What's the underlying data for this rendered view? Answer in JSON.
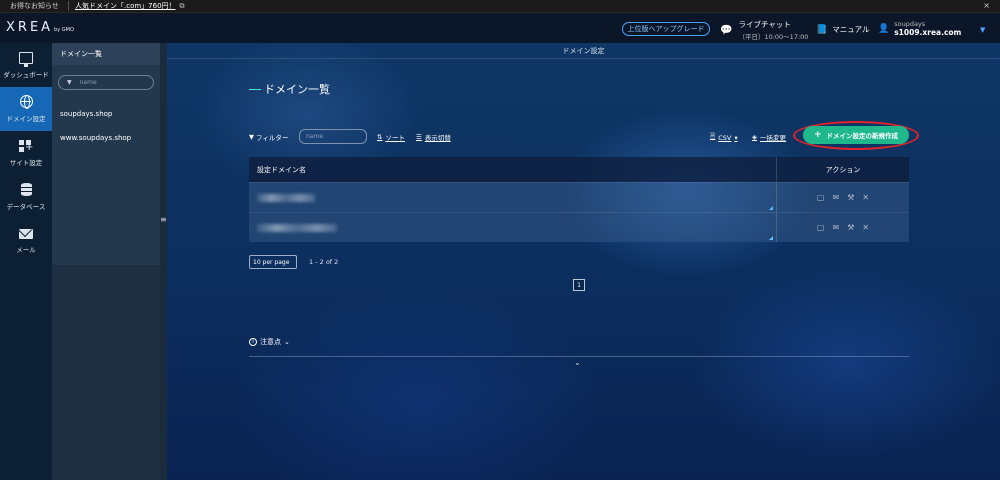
{
  "notice": {
    "label": "お得なお知らせ",
    "link": "人気ドメイン「.com」760円！",
    "ext_icon": "external-link-icon",
    "close": "×"
  },
  "header": {
    "logo": "XREA",
    "logo_sub": "by GMO",
    "upgrade": "上位版へアップグレード",
    "chat_title": "ライブチャット",
    "chat_hours": "（平日）10:00〜17:00",
    "manual": "マニュアル",
    "user_name": "soupdays",
    "user_host": "s1009.xrea.com"
  },
  "nav": [
    {
      "label": "ダッシュボード",
      "icon": "monitor-icon",
      "active": false
    },
    {
      "label": "ドメイン設定",
      "icon": "globe-icon",
      "active": true
    },
    {
      "label": "サイト設定",
      "icon": "grid-plus-icon",
      "active": false
    },
    {
      "label": "データベース",
      "icon": "database-icon",
      "active": false
    },
    {
      "label": "メール",
      "icon": "mail-icon",
      "active": false
    }
  ],
  "panel": {
    "title": "ドメイン一覧",
    "search_placeholder": "name",
    "items": [
      "soupdays.shop",
      "www.soupdays.shop"
    ]
  },
  "main": {
    "bar_title": "ドメイン設定",
    "page_title": "ドメイン一覧",
    "filter": "フィルター",
    "filter_placeholder": "name",
    "sort": "ソート",
    "view_toggle": "表示切替",
    "csv": "CSV",
    "bulk_change": "一括変更",
    "new_button": "ドメイン設定の新規作成",
    "table": {
      "col_name": "設定ドメイン名",
      "col_action": "アクション",
      "rows": [
        {},
        {}
      ]
    },
    "per_page": "10 per page",
    "count": "1 - 2 of 2",
    "page": "1",
    "notes": "注意点"
  },
  "colors": {
    "accent": "#1fb88d",
    "nav_active": "#1668b6",
    "highlight_ring": "#e0242c"
  }
}
